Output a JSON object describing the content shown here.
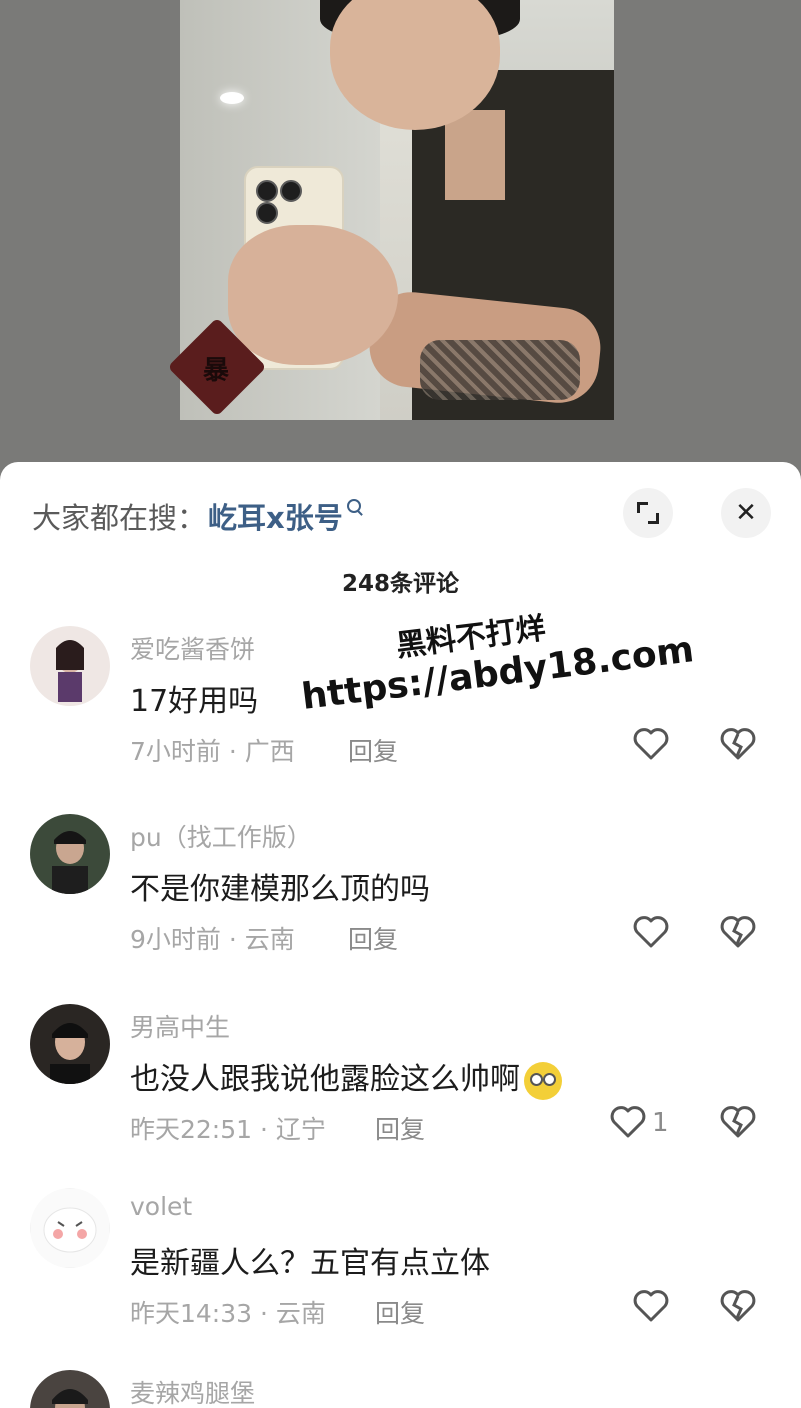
{
  "video": {
    "sticker_text": "暴"
  },
  "search": {
    "prefix": "大家都在搜：",
    "keyword": "屹耳x张号"
  },
  "controls": {
    "expand_icon": "expand-icon",
    "close_icon": "close-icon",
    "close_glyph": "✕"
  },
  "comments_count": "248条评论",
  "comments": [
    {
      "username": "爱吃酱香饼",
      "text": "17好用吗",
      "time_location": "7小时前 · 广西",
      "reply": "回复",
      "likes": ""
    },
    {
      "username": "pu（找工作版）",
      "text": "不是你建模那么顶的吗",
      "time_location": "9小时前 · 云南",
      "reply": "回复",
      "likes": ""
    },
    {
      "username": "男高中生",
      "text": "也没人跟我说他露脸这么帅啊",
      "time_location": "昨天22:51 · 辽宁",
      "reply": "回复",
      "likes": "1"
    },
    {
      "username": "volet",
      "text": "是新疆人么？五官有点立体",
      "time_location": "昨天14:33 · 云南",
      "reply": "回复",
      "likes": ""
    },
    {
      "username": "麦辣鸡腿堡"
    }
  ],
  "watermark": {
    "title": "黑料不打烊",
    "url": "https://abdy18.com"
  },
  "colors": {
    "keyword": "#3d5f86",
    "meta": "#a6a6a6",
    "text": "#1c1c1c",
    "sheet_bg": "#ffffff",
    "backdrop": "#7d7d7b"
  }
}
